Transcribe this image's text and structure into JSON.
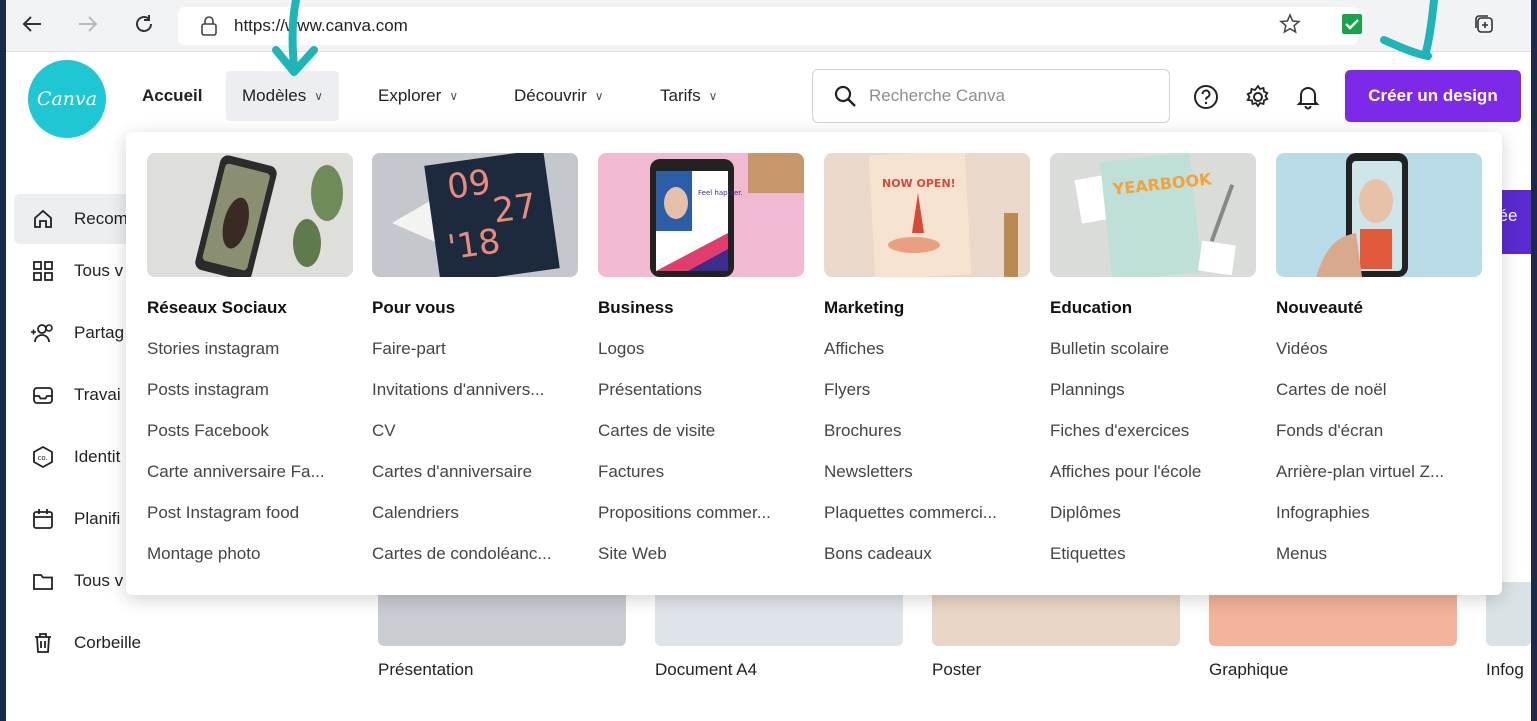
{
  "browser": {
    "url": "https://www.canva.com"
  },
  "header": {
    "logo_text": "Canva",
    "nav": [
      {
        "label": "Accueil"
      },
      {
        "label": "Modèles"
      },
      {
        "label": "Explorer"
      },
      {
        "label": "Découvrir"
      },
      {
        "label": "Tarifs"
      }
    ],
    "search_placeholder": "Recherche Canva",
    "cta_label": "Créer un design",
    "accent_color": "#7d2ae8",
    "logo_color": "#1fc6d4"
  },
  "sidebar": {
    "items": [
      {
        "label": "Recom",
        "icon": "home-icon"
      },
      {
        "label": "Tous v",
        "icon": "grid-icon"
      },
      {
        "label": "Partag",
        "icon": "shared-users-icon"
      },
      {
        "label": "Travai",
        "icon": "inbox-icon"
      },
      {
        "label": "Identit",
        "icon": "brand-kit-icon"
      },
      {
        "label": "Planifi",
        "icon": "calendar-icon"
      },
      {
        "label": "Tous v",
        "icon": "folder-icon"
      },
      {
        "label": "Corbeille",
        "icon": "trash-icon"
      }
    ]
  },
  "main": {
    "banner_text": "sée",
    "cards": [
      {
        "label": "Présentation"
      },
      {
        "label": "Document A4"
      },
      {
        "label": "Poster"
      },
      {
        "label": "Graphique"
      },
      {
        "label": "Infog"
      }
    ]
  },
  "dropdown": {
    "columns": [
      {
        "title": "Réseaux Sociaux",
        "items": [
          "Stories instagram",
          "Posts instagram",
          "Posts Facebook",
          "Carte anniversaire Fa...",
          "Post Instagram food",
          "Montage photo"
        ]
      },
      {
        "title": "Pour vous",
        "items": [
          "Faire-part",
          "Invitations d'annivers...",
          "CV",
          "Cartes d'anniversaire",
          "Calendriers",
          "Cartes de condoléanc..."
        ]
      },
      {
        "title": "Business",
        "items": [
          "Logos",
          "Présentations",
          "Cartes de visite",
          "Factures",
          "Propositions commer...",
          "Site Web"
        ]
      },
      {
        "title": "Marketing",
        "items": [
          "Affiches",
          "Flyers",
          "Brochures",
          "Newsletters",
          "Plaquettes commerci...",
          "Bons cadeaux"
        ]
      },
      {
        "title": "Education",
        "items": [
          "Bulletin scolaire",
          "Plannings",
          "Fiches d'exercices",
          "Affiches pour l'école",
          "Diplômes",
          "Etiquettes"
        ]
      },
      {
        "title": "Nouveauté",
        "items": [
          "Vidéos",
          "Cartes de noël",
          "Fonds d'écran",
          "Arrière-plan virtuel Z...",
          "Infographies",
          "Menus"
        ]
      }
    ],
    "thumb_texts": {
      "date_top": "09",
      "date_mid": "27",
      "date_year": "'18",
      "now_open": "NOW OPEN!",
      "yearbook": "YEARBOOK",
      "feel_happier": "Feel happier."
    }
  }
}
